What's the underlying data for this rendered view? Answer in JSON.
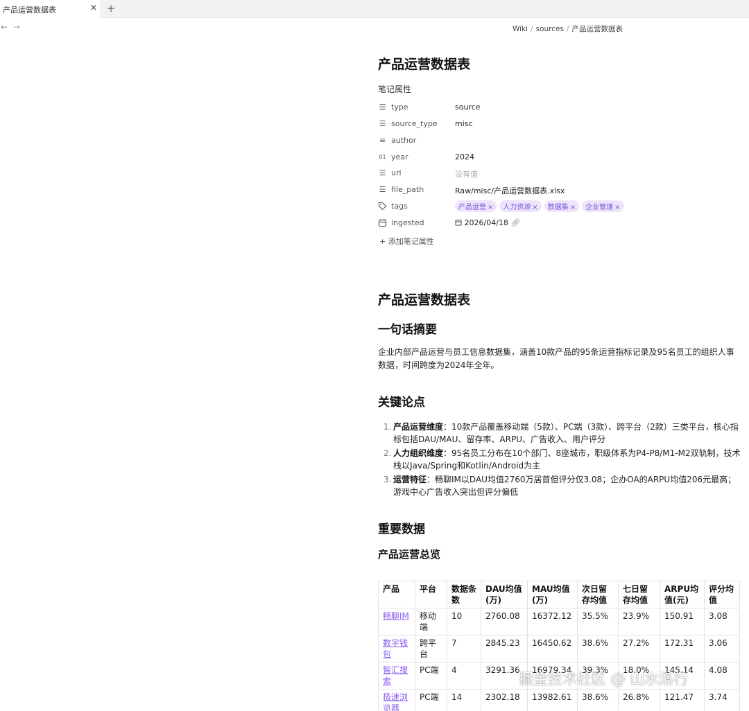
{
  "tab": {
    "title": "产品运营数据表",
    "close": "×",
    "new_tab": "+"
  },
  "nav": {
    "back": "←",
    "forward": "→"
  },
  "breadcrumb": [
    "Wiki",
    "sources",
    "产品运营数据表"
  ],
  "note_title": "产品运营数据表",
  "properties": {
    "heading": "笔记属性",
    "type": {
      "key": "type",
      "value": "source"
    },
    "source_type": {
      "key": "source_type",
      "value": "misc"
    },
    "author": {
      "key": "author",
      "value": ""
    },
    "year": {
      "key": "year",
      "value": "2024"
    },
    "url": {
      "key": "url",
      "value": "没有值"
    },
    "file_path": {
      "key": "file_path",
      "value": "Raw/misc/产品运营数据表.xlsx"
    },
    "tags": {
      "key": "tags",
      "values": [
        "产品运营",
        "人力资源",
        "数据集",
        "企业管理"
      ]
    },
    "ingested": {
      "key": "ingested",
      "value": "2026/04/18"
    },
    "add_label": "添加笔记属性"
  },
  "doc": {
    "h1": "产品运营数据表",
    "summary_heading": "一句话摘要",
    "summary": "企业内部产品运营与员工信息数据集，涵盖10款产品的95条运营指标记录及95名员工的组织人事数据，时间跨度为2024年全年。",
    "points_heading": "关键论点",
    "points": [
      {
        "num": "1.",
        "bold": "产品运营维度",
        "text": "：10款产品覆盖移动端（5款）、PC端（3款）、跨平台（2款）三类平台，核心指标包括DAU/MAU、留存率、ARPU、广告收入、用户评分"
      },
      {
        "num": "2.",
        "bold": "人力组织维度",
        "text": "：95名员工分布在10个部门、8座城市，职级体系为P4-P8/M1-M2双轨制，技术栈以Java/Spring和Kotlin/Android为主"
      },
      {
        "num": "3.",
        "bold": "运营特征",
        "text": "：畅聊IM以DAU均值2760万居首但评分仅3.08；企办OA的ARPU均值206元最高；游戏中心广告收入突出但评分偏低"
      }
    ],
    "data_heading": "重要数据",
    "table_heading": "产品运营总览",
    "table": {
      "headers": [
        "产品",
        "平台",
        "数据条数",
        "DAU均值(万)",
        "MAU均值(万)",
        "次日留存均值",
        "七日留存均值",
        "ARPU均值(元)",
        "评分均值"
      ],
      "rows": [
        [
          "畅聊IM",
          "移动端",
          "10",
          "2760.08",
          "16372.12",
          "35.5%",
          "23.9%",
          "150.91",
          "3.08"
        ],
        [
          "数字钱包",
          "跨平台",
          "7",
          "2845.23",
          "16450.62",
          "38.6%",
          "27.2%",
          "172.31",
          "3.06"
        ],
        [
          "智汇搜索",
          "PC端",
          "4",
          "3291.36",
          "16979.34",
          "39.3%",
          "18.0%",
          "145.14",
          "4.08"
        ],
        [
          "极速浏览器",
          "PC端",
          "14",
          "2302.18",
          "13982.61",
          "38.6%",
          "26.8%",
          "121.47",
          "3.74"
        ]
      ]
    }
  },
  "watermark": "掘金技术社区 @ 山水洛行"
}
